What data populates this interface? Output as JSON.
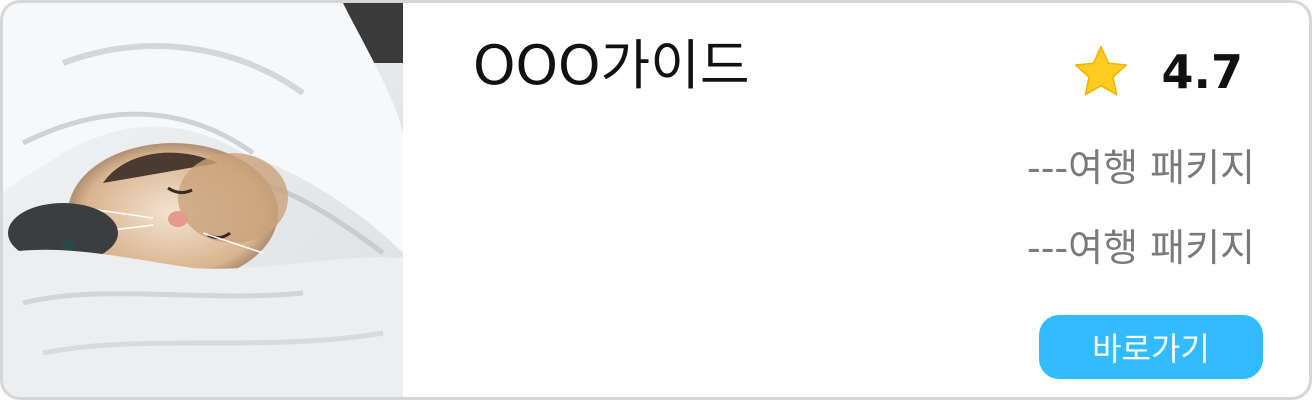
{
  "card": {
    "title": "OOO가이드",
    "rating": "4.7",
    "packages": [
      "---여행 패키지",
      "---여행 패키지"
    ],
    "button_label": "바로가기",
    "image_subject": "cat-sleeping-under-blanket"
  },
  "colors": {
    "accent": "#33bbff",
    "star": "#ffcc22",
    "border": "#d6d6d6",
    "muted_text": "#7a7a7a"
  },
  "icons": {
    "rating": "star-icon"
  }
}
